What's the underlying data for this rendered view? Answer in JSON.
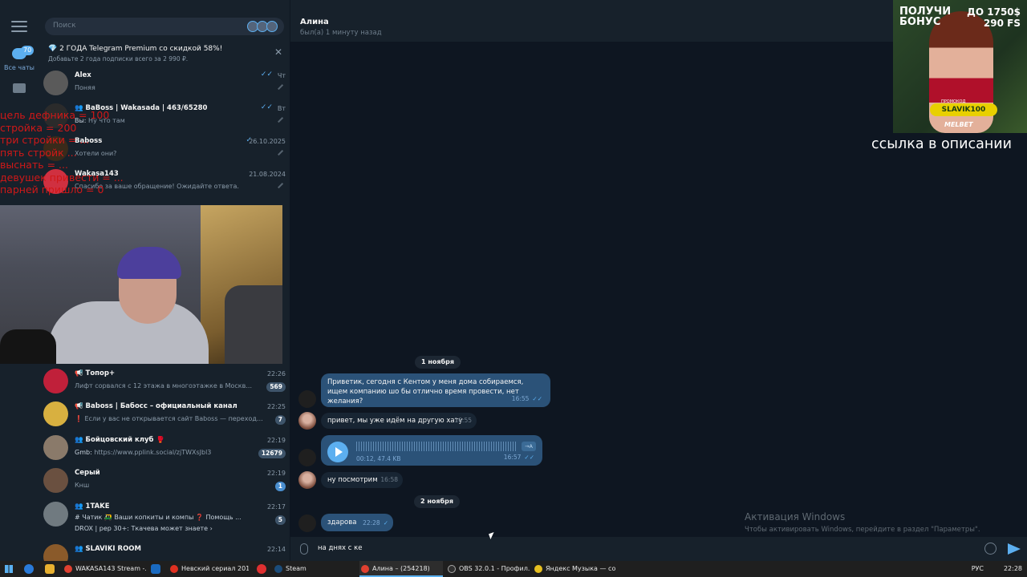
{
  "rail": {
    "all_chats_label": "Все чаты",
    "all_chats_badge": "70"
  },
  "search": {
    "placeholder": "Поиск"
  },
  "promo": {
    "title": "💎 2 ГОДА Telegram Premium со скидкой 58%!",
    "subtitle": "Добавьте 2 года подписки всего за 2 990 ₽."
  },
  "chats_top": [
    {
      "name": "Alex",
      "message": "Поняя",
      "time": "Чт",
      "ticks": "✓✓"
    },
    {
      "name": "👥 BaBoss | Wakasada | 463/65280",
      "sender": "Вы:",
      "message": "Ну что там",
      "time": "Вт",
      "ticks": "✓✓"
    },
    {
      "name": "Baboss",
      "message": "Хотели они?",
      "time": "26.10.2025",
      "ticks": "✓"
    },
    {
      "name": "Wakasa143",
      "message": "Спасибо за ваше обращение! Ожидайте ответа.",
      "time": "21.08.2024"
    }
  ],
  "chats_bottom": [
    {
      "name": "📢 Топор+",
      "message": "Лифт сорвался с 12 этажа в многоэтажке в Москв...",
      "time": "22:26",
      "badge": "569",
      "badge_style": "muted"
    },
    {
      "name": "📢 Baboss | Бабосс – официальный канал",
      "message": "❗ Если у вас не открывается сайт Baboss — переходите п...",
      "time": "22:25",
      "badge": "7",
      "badge_style": "muted"
    },
    {
      "name": "👥 Бойцовский клуб 🥊",
      "sender": "Gmb:",
      "message": "https://www.pplink.social/zjTWXsJbl3",
      "time": "22:19",
      "badge": "12679",
      "badge_style": "muted"
    },
    {
      "name": "Серый",
      "message": "Кнш",
      "time": "22:19",
      "badge": "1",
      "badge_style": "blue"
    },
    {
      "name": "👥 1TAKE",
      "sender": "# Чатик",
      "message": "🛺 Ваши копкиты и компы ❓ Помощь ...",
      "message2": "DROX | pep 30+: Ткачева может знаете ›",
      "time": "22:17",
      "badge": "5",
      "badge_style": "muted"
    },
    {
      "name": "👥 SLAVIKI ROOM",
      "message": "",
      "time": "22:14"
    }
  ],
  "overlay_lines": [
    "цель дефника = 100",
    "стройка = 200",
    "три стройки = ...",
    "пять стройк ...",
    "выснать = ...",
    "девушек привести = ...",
    "парней пришло = 0"
  ],
  "conversation": {
    "name": "Алина",
    "status": "был(а) 1 минуту назад",
    "date1": "1 ноября",
    "date2": "2 ноября",
    "m1_text": "Приветик, сегодня с Кентом у меня дома собираемся, ищем компанию шо бы отлично время провести, нет желания?",
    "m1_time": "16:55",
    "m2_text": "привет, мы уже идём на другую хату",
    "m2_time": "16:55",
    "voice_meta": "00:12, 47.4 KB",
    "voice_time": "16:57",
    "voice_tr": "→A",
    "m4_text": "ну посмотрим",
    "m4_time": "16:58",
    "m5_text": "здарова",
    "m5_time": "22:28",
    "input_text": "на днях с ке"
  },
  "watermark": {
    "title": "Активация Windows",
    "body": "Чтобы активировать Windows, перейдите в раздел \"Параметры\"."
  },
  "ad": {
    "line1": "ПОЛУЧИ БОНУС",
    "line2a": "ДО 1750$",
    "line2b": "290 FS",
    "promo_label": "ПРОМОКОД",
    "code": "SLAVIK100",
    "brand": "MELBET",
    "caption": "ссылка в описании"
  },
  "taskbar": {
    "apps": [
      "WAKASA143 Stream -...",
      "Невский сериал 201...",
      "Steam",
      "Алина – (254218)",
      "OBS 32.0.1 - Профил...",
      "Яндекс Музыка — со..."
    ],
    "lang": "РУС",
    "time": "22:28"
  },
  "colors": {
    "accent": "#5caff0",
    "out_bubble": "#2b5278",
    "in_bubble": "#182533",
    "overlay_text": "#d01818"
  }
}
